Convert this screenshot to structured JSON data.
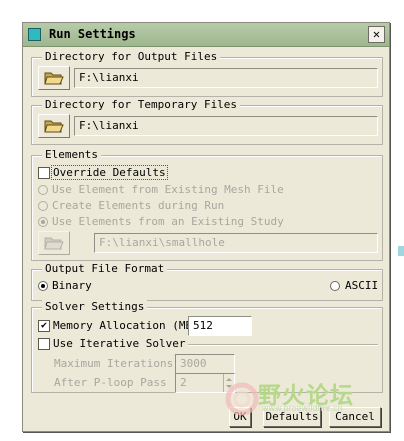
{
  "window": {
    "title": "Run Settings",
    "close_glyph": "✕"
  },
  "output_dir": {
    "legend": "Directory for Output Files",
    "value": "F:\\lianxi"
  },
  "temp_dir": {
    "legend": "Directory for Temporary Files",
    "value": "F:\\lianxi"
  },
  "elements": {
    "legend": "Elements",
    "override_label": "Override Defaults",
    "override_checked": false,
    "options": [
      {
        "label": "Use Element from Existing Mesh File",
        "selected": false,
        "enabled": false
      },
      {
        "label": "Create Elements during Run",
        "selected": false,
        "enabled": false
      },
      {
        "label": "Use Elements from an Existing Study",
        "selected": true,
        "enabled": false
      }
    ],
    "study_path": "F:\\lianxi\\smallhole"
  },
  "output_format": {
    "legend": "Output File Format",
    "options": [
      {
        "label": "Binary",
        "selected": true
      },
      {
        "label": "ASCII",
        "selected": false
      }
    ]
  },
  "solver": {
    "legend": "Solver Settings",
    "memory_label": "Memory Allocation (MB)",
    "memory_checked": true,
    "memory_value": "512",
    "iterative_label": "Use Iterative Solver",
    "iterative_checked": false,
    "max_iter_label": "Maximum  Iterations",
    "max_iter_value": "3000",
    "ploop_label": "After P-loop Pass",
    "ploop_value": "2"
  },
  "buttons": {
    "ok": "OK",
    "defaults": "Defaults",
    "cancel": "Cancel"
  },
  "watermark": {
    "text": "野火论坛",
    "url": "www.proewildfire.cn"
  },
  "colors": {
    "title_bar": "#a9bf99",
    "dialog_bg": "#ece9d8",
    "accent_icon": "#2fbac0",
    "watermark": "#b6d88a"
  }
}
